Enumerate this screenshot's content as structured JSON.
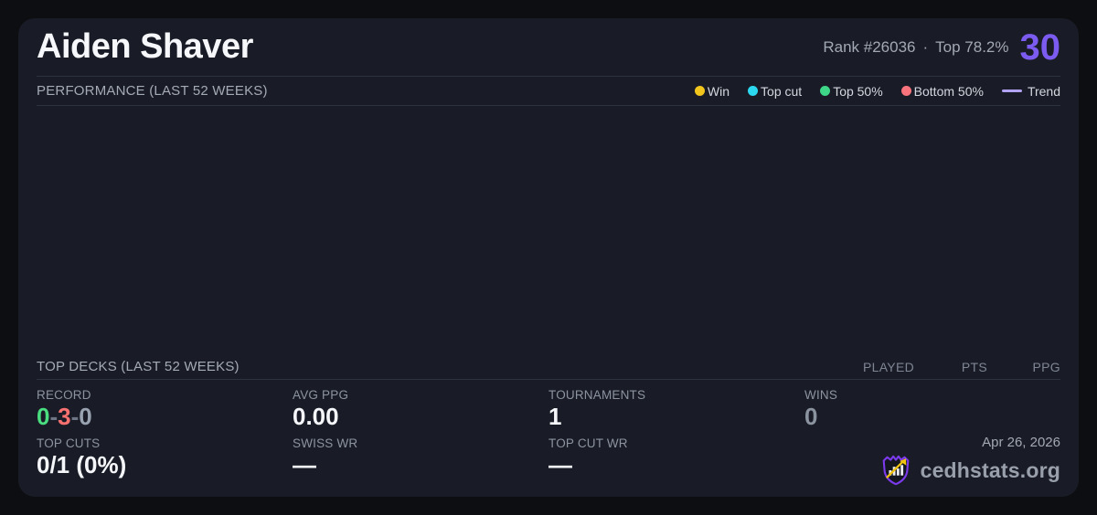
{
  "header": {
    "player_name": "Aiden Shaver",
    "rank": "Rank #26036",
    "dot_separator": "·",
    "top_percent": "Top 78.2%",
    "score": "30",
    "score_color": "#7c5cf0"
  },
  "performance": {
    "section_title": "PERFORMANCE (LAST 52 WEEKS)",
    "legend": {
      "win": {
        "label": "Win",
        "color": "#f2c51d"
      },
      "top_cut": {
        "label": "Top cut",
        "color": "#2cd7f0"
      },
      "top50": {
        "label": "Top 50%",
        "color": "#3ed687"
      },
      "bottom50": {
        "label": "Bottom 50%",
        "color": "#f8737c"
      },
      "trend": {
        "label": "Trend",
        "color": "#b3a3f5"
      }
    }
  },
  "chart_data": {
    "type": "scatter",
    "title": "PERFORMANCE (LAST 52 WEEKS)",
    "x": [],
    "series": [
      {
        "name": "Win",
        "values": []
      },
      {
        "name": "Top cut",
        "values": []
      },
      {
        "name": "Top 50%",
        "values": []
      },
      {
        "name": "Bottom 50%",
        "values": []
      },
      {
        "name": "Trend",
        "values": []
      }
    ],
    "note": "chart plot area is empty in the screenshot - no points or trend line rendered"
  },
  "top_decks": {
    "section_title": "TOP DECKS (LAST 52 WEEKS)",
    "columns": {
      "played": "PLAYED",
      "pts": "PTS",
      "ppg": "PPG"
    },
    "rows": []
  },
  "stats": {
    "record": {
      "label": "RECORD",
      "wins": "0",
      "losses": "3",
      "draws": "0",
      "separator": "-",
      "wins_color": "#4ade80",
      "losses_color": "#f87171",
      "draws_color": "#98a2b0"
    },
    "avg_ppg": {
      "label": "AVG PPG",
      "value": "0.00"
    },
    "tournaments": {
      "label": "TOURNAMENTS",
      "value": "1"
    },
    "wins": {
      "label": "WINS",
      "value": "0"
    },
    "top_cuts": {
      "label": "TOP CUTS",
      "value": "0/1 (0%)"
    },
    "swiss_wr": {
      "label": "SWISS WR",
      "value": "—"
    },
    "top_cut_wr": {
      "label": "TOP CUT WR",
      "value": "—"
    }
  },
  "footer": {
    "date": "Apr 26, 2026",
    "brand": "cedhstats.org"
  }
}
